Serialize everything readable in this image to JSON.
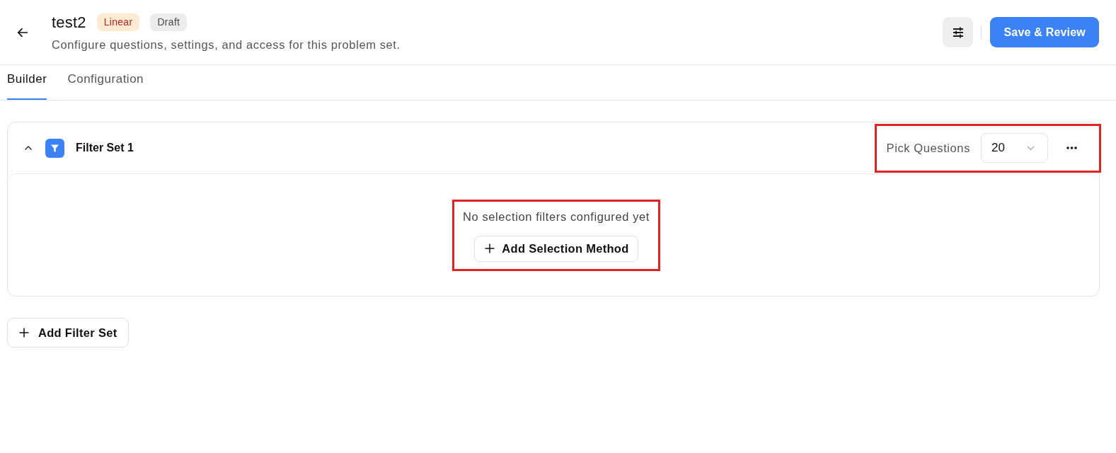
{
  "header": {
    "title": "test2",
    "badges": [
      {
        "label": "Linear",
        "kind": "warning"
      },
      {
        "label": "Draft",
        "kind": "neutral"
      }
    ],
    "subtitle": "Configure questions, settings, and access for this problem set.",
    "primary_button": "Save & Review"
  },
  "tabs": [
    {
      "label": "Builder",
      "selected": true
    },
    {
      "label": "Configuration",
      "selected": false
    }
  ],
  "filter_sets": [
    {
      "title": "Filter Set 1",
      "expanded": true,
      "pick_questions": {
        "label": "Pick Questions",
        "value": "20",
        "highlighted": true
      },
      "empty_state": {
        "message": "No selection filters configured yet",
        "button": "Add Selection Method",
        "highlighted": true
      }
    }
  ],
  "add_filter_set_button": "Add Filter Set"
}
